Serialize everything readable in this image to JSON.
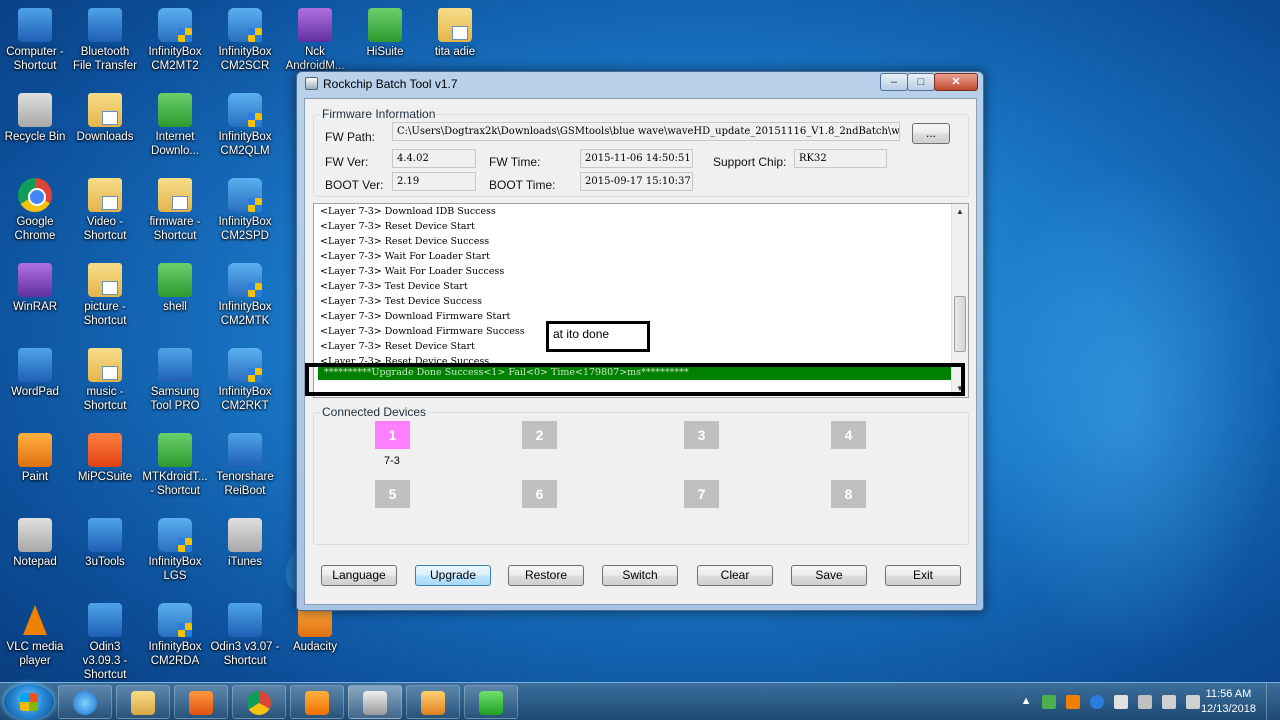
{
  "desktop": {
    "icons": [
      {
        "label": "Computer - Shortcut"
      },
      {
        "label": "Bluetooth File Transfer"
      },
      {
        "label": "InfinityBox CM2MT2"
      },
      {
        "label": "InfinityBox CM2SCR"
      },
      {
        "label": "Nck AndroidM..."
      },
      {
        "label": "HiSuite"
      },
      {
        "label": "tita adie"
      },
      {
        "label": "Recycle Bin"
      },
      {
        "label": "Downloads"
      },
      {
        "label": "Internet Downlo..."
      },
      {
        "label": "InfinityBox CM2QLM"
      },
      {
        "label": "Google Chrome"
      },
      {
        "label": "Video - Shortcut"
      },
      {
        "label": "firmware - Shortcut"
      },
      {
        "label": "InfinityBox CM2SPD"
      },
      {
        "label": "WinRAR"
      },
      {
        "label": "picture - Shortcut"
      },
      {
        "label": "shell"
      },
      {
        "label": "InfinityBox CM2MTK"
      },
      {
        "label": "WordPad"
      },
      {
        "label": "music - Shortcut"
      },
      {
        "label": "Samsung Tool PRO"
      },
      {
        "label": "InfinityBox CM2RKT"
      },
      {
        "label": "Paint"
      },
      {
        "label": "MiPCSuite"
      },
      {
        "label": "MTKdroidT... - Shortcut"
      },
      {
        "label": "Tenorshare ReiBoot"
      },
      {
        "label": "Notepad"
      },
      {
        "label": "3uTools"
      },
      {
        "label": "InfinityBox LGS"
      },
      {
        "label": "iTunes"
      },
      {
        "label": "VLC media player"
      },
      {
        "label": "Odin3 v3.09.3 - Shortcut"
      },
      {
        "label": "InfinityBox CM2RDA"
      },
      {
        "label": "Odin3 v3.07 - Shortcut"
      },
      {
        "label": "Audacity"
      }
    ]
  },
  "window": {
    "title": "Rockchip Batch Tool v1.7",
    "controls": {
      "minimize": "–",
      "maximize": "□",
      "close": "✕"
    }
  },
  "firmware": {
    "legend": "Firmware Information",
    "fw_path_label": "FW Path:",
    "fw_path": "C:\\Users\\Dogtrax2k\\Downloads\\GSMtools\\blue wave\\waveHD_update_20151116_V1.8_2ndBatch\\wave",
    "browse_label": "...",
    "fw_ver_label": "FW Ver:",
    "fw_ver": "4.4.02",
    "fw_time_label": "FW Time:",
    "fw_time": "2015-11-06 14:50:51",
    "support_chip_label": "Support Chip:",
    "support_chip": "RK32",
    "boot_ver_label": "BOOT Ver:",
    "boot_ver": "2.19",
    "boot_time_label": "BOOT Time:",
    "boot_time": "2015-09-17 15:10:37"
  },
  "log": {
    "lines": [
      "<Layer 7-3> Download IDB Success",
      "<Layer 7-3> Reset Device Start",
      "<Layer 7-3> Reset Device Success",
      "<Layer 7-3> Wait For Loader Start",
      "<Layer 7-3> Wait For Loader Success",
      "<Layer 7-3> Test Device Start",
      "<Layer 7-3> Test Device Success",
      "<Layer 7-3> Download Firmware Start",
      "<Layer 7-3> Download Firmware Success",
      "<Layer 7-3> Reset Device Start",
      "<Layer 7-3> Reset Device Success"
    ],
    "done_line": "**********Upgrade Done Success<1> Fail<0> Time<179807>ms**********",
    "annotation": "at ito done"
  },
  "devices": {
    "legend": "Connected Devices",
    "slots": [
      "1",
      "2",
      "3",
      "4",
      "5",
      "6",
      "7",
      "8"
    ],
    "slot1_label": "7-3"
  },
  "buttons": {
    "language": "Language",
    "upgrade": "Upgrade",
    "restore": "Restore",
    "switch": "Switch",
    "clear": "Clear",
    "save": "Save",
    "exit": "Exit"
  },
  "taskbar": {
    "time": "11:56 AM",
    "date": "12/13/2018"
  },
  "colors": {
    "done_bar": "#008000",
    "active_device": "#ff80ff",
    "inactive_device": "#c0c0c0"
  }
}
